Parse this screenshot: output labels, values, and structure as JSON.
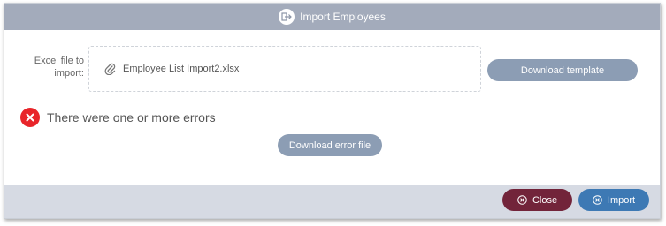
{
  "dialog": {
    "title": "Import Employees",
    "title_icon": "import-arrow-icon"
  },
  "form": {
    "file_label": "Excel file to import:",
    "file_name": "Employee List Import2.xlsx",
    "attach_icon": "paperclip-icon",
    "download_template_label": "Download template"
  },
  "status": {
    "error_icon": "error-x-icon",
    "error_text": "There were one or more errors",
    "download_error_label": "Download error file"
  },
  "footer": {
    "close_label": "Close",
    "import_label": "Import"
  },
  "colors": {
    "titlebar": "#a3abbb",
    "button_neutral": "#8c9db4",
    "close_button": "#72243a",
    "import_button": "#3d79b4",
    "error": "#e8252a",
    "footer": "#d6dae3"
  }
}
